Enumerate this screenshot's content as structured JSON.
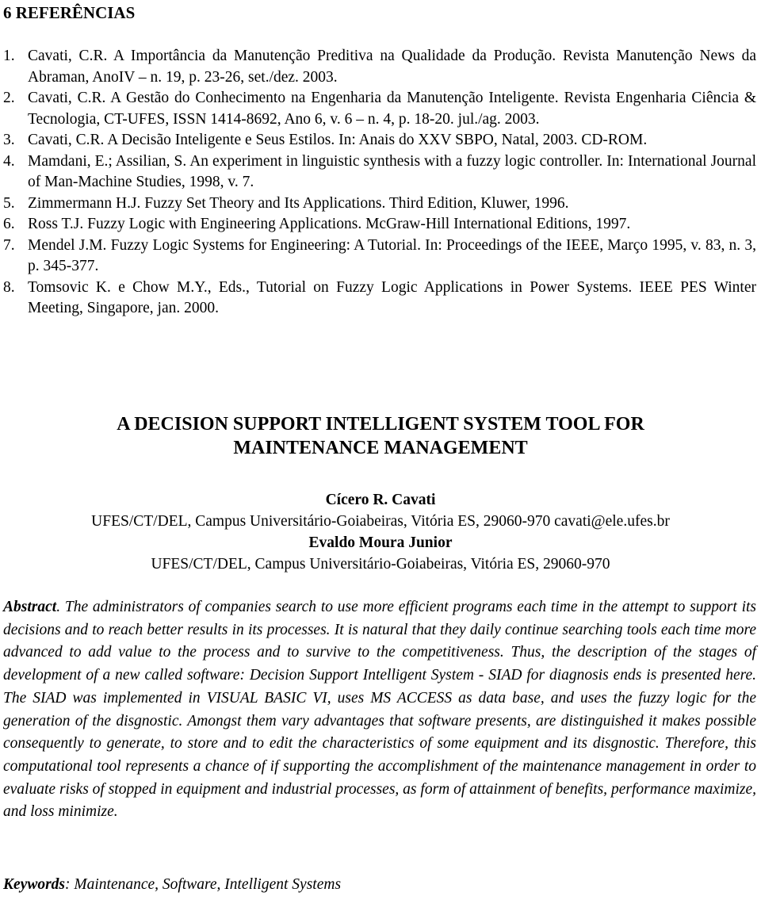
{
  "references": {
    "heading": "6 REFERÊNCIAS",
    "items": [
      {
        "num": "1.",
        "text": "Cavati, C.R.  A Importância da Manutenção Preditiva na Qualidade da Produção. Revista Manutenção News da Abraman, AnoIV – n. 19, p. 23-26, set./dez. 2003."
      },
      {
        "num": "2.",
        "text": "Cavati, C.R.  A Gestão do Conhecimento na Engenharia da Manutenção Inteligente. Revista Engenharia Ciência & Tecnologia, CT-UFES, ISSN 1414-8692, Ano 6, v. 6 – n. 4, p. 18-20. jul./ag. 2003."
      },
      {
        "num": "3.",
        "text": "Cavati, C.R. A Decisão Inteligente e Seus Estilos. In: Anais do XXV SBPO, Natal, 2003. CD-ROM."
      },
      {
        "num": "4.",
        "text": "Mamdani, E.; Assilian, S. An experiment in linguistic synthesis with a fuzzy logic controller. In: International Journal of Man-Machine Studies, 1998, v. 7."
      },
      {
        "num": "5.",
        "text": "Zimmermann H.J. Fuzzy Set Theory and Its Applications. Third Edition, Kluwer, 1996."
      },
      {
        "num": "6.",
        "text": "Ross T.J. Fuzzy Logic with Engineering Applications. McGraw-Hill International Editions, 1997."
      },
      {
        "num": "7.",
        "text": "Mendel J.M. Fuzzy Logic Systems for Engineering: A Tutorial. In: Proceedings of the IEEE, Março 1995, v. 83, n. 3, p. 345-377."
      },
      {
        "num": "8.",
        "text": "Tomsovic K. e Chow M.Y., Eds., Tutorial on Fuzzy Logic Applications in Power Systems. IEEE PES Winter Meeting, Singapore, jan. 2000."
      }
    ]
  },
  "paper": {
    "title_line1": "A DECISION SUPPORT INTELLIGENT SYSTEM TOOL FOR",
    "title_line2": "MAINTENANCE MANAGEMENT",
    "authors": [
      {
        "name": "Cícero R. Cavati",
        "affiliation": "UFES/CT/DEL, Campus Universitário-Goiabeiras, Vitória ES, 29060-970 cavati@ele.ufes.br"
      },
      {
        "name": "Evaldo Moura Junior",
        "affiliation": "UFES/CT/DEL, Campus Universitário-Goiabeiras, Vitória ES, 29060-970"
      }
    ],
    "abstract_label": "Abstract",
    "abstract_text": ". The administrators of companies search to use more efficient programs each time in the attempt to support its decisions and to reach better results in its processes.  It is natural that they daily continue searching tools each time more advanced to add value to the process and to survive to the competitiveness.  Thus, the description of the stages of development of a new called software: Decision Support Intelligent System - SIAD for diagnosis ends is presented here.  The SIAD was implemented in VISUAL BASIC VI, uses MS ACCESS as data base, and uses the fuzzy logic for the generation of the disgnostic.  Amongst them vary advantages that software presents, are distinguished it makes possible consequently to generate, to store and to edit the characteristics of some equipment and its disgnostic.  Therefore, this computational tool represents a chance of if supporting the accomplishment of the maintenance management in order to evaluate risks of stopped in equipment and industrial processes, as form of attainment of benefits, performance maximize, and loss minimize.",
    "keywords_label": "Keywords",
    "keywords_text": ": Maintenance, Software, Intelligent Systems"
  }
}
